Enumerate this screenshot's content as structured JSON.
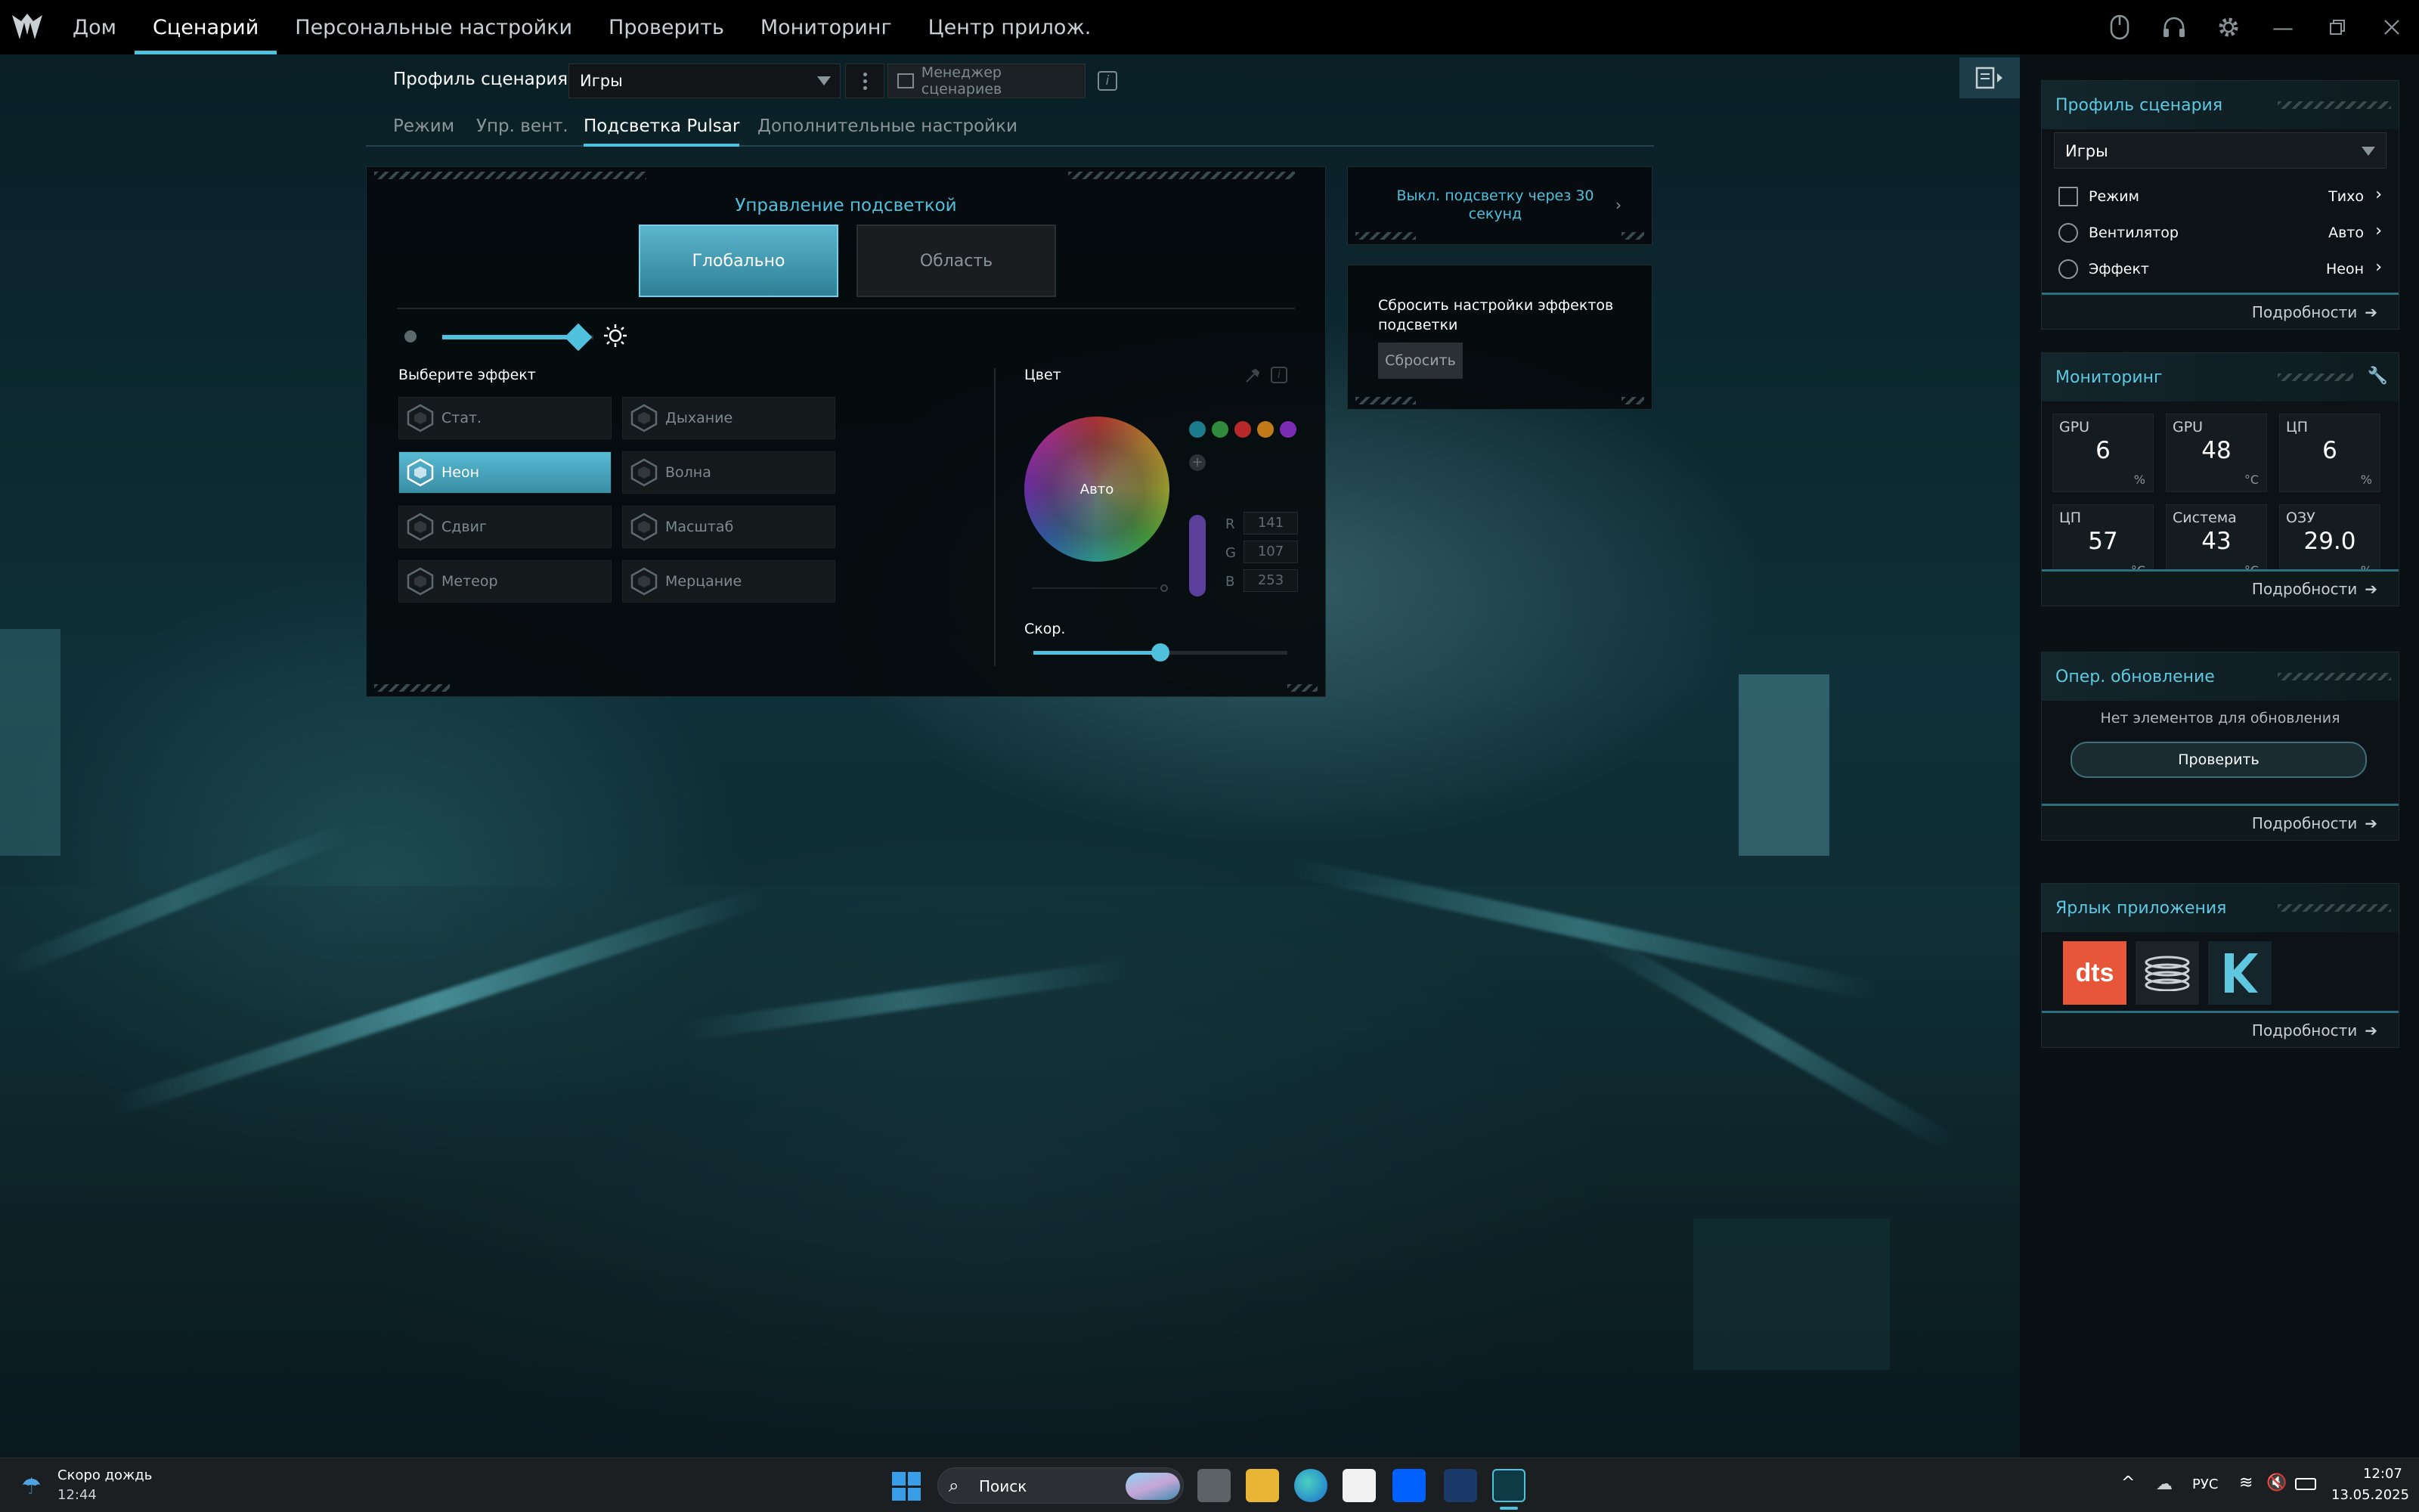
{
  "nav": {
    "items": [
      "Дом",
      "Сценарий",
      "Персональные настройки",
      "Проверить",
      "Мониторинг",
      "Центр прилож."
    ],
    "active_index": 1
  },
  "profile": {
    "label": "Профиль сценария",
    "value": "Игры",
    "manager_label": "Менеджер сценариев"
  },
  "subtabs": {
    "items": [
      "Режим",
      "Упр. вент.",
      "Подсветка Pulsar",
      "Дополнительные настройки"
    ],
    "active_index": 2
  },
  "lighting": {
    "title": "Управление подсветкой",
    "global_label": "Глобально",
    "area_label": "Область",
    "brightness": 0.9,
    "effects_title": "Выберите эффект",
    "effects": [
      "Стат.",
      "Дыхание",
      "Неон",
      "Волна",
      "Сдвиг",
      "Масштаб",
      "Метеор",
      "Мерцание"
    ],
    "selected_effect": "Неон",
    "color_title": "Цвет",
    "wheel_label": "Авто",
    "rgb": {
      "r_label": "R",
      "g_label": "G",
      "b_label": "B",
      "r": "141",
      "g": "107",
      "b": "253"
    },
    "swatches": [
      "#1b7d8c",
      "#2f8a3c",
      "#b8282b",
      "#c07a1a",
      "#7a2ab3"
    ],
    "speed_label": "Скор.",
    "speed": 0.5
  },
  "side_cards": {
    "off_timer": "Выкл. подсветку через 30 секунд",
    "reset_text": "Сбросить настройки эффектов подсветки",
    "reset_button": "Сбросить"
  },
  "sidebar": {
    "profile": {
      "title": "Профиль сценария",
      "value": "Игры",
      "rows": [
        {
          "label": "Режим",
          "value": "Тихо"
        },
        {
          "label": "Вентилятор",
          "value": "Авто"
        },
        {
          "label": "Эффект",
          "value": "Неон"
        }
      ],
      "more": "Подробности"
    },
    "monitoring": {
      "title": "Мониторинг",
      "tiles": [
        {
          "t": "GPU",
          "v": "6",
          "u": "%"
        },
        {
          "t": "GPU",
          "v": "48",
          "u": "°C"
        },
        {
          "t": "ЦП",
          "v": "6",
          "u": "%"
        },
        {
          "t": "ЦП",
          "v": "57",
          "u": "°C"
        },
        {
          "t": "Система",
          "v": "43",
          "u": "°C"
        },
        {
          "t": "ОЗУ",
          "v": "29.0",
          "u": "%"
        }
      ],
      "more": "Подробности"
    },
    "update": {
      "title": "Опер. обновление",
      "text": "Нет элементов для обновления",
      "button": "Проверить",
      "more": "Подробности"
    },
    "shortcuts": {
      "title": "Ярлык приложения",
      "more": "Подробности"
    }
  },
  "taskbar": {
    "weather_title": "Скоро дождь",
    "weather_time": "12:44",
    "search": "Поиск",
    "lang": "РУС",
    "time": "12:07",
    "date": "13.05.2025"
  },
  "colors": {
    "accent": "#4fc1dd",
    "dts": "#e8563a"
  }
}
